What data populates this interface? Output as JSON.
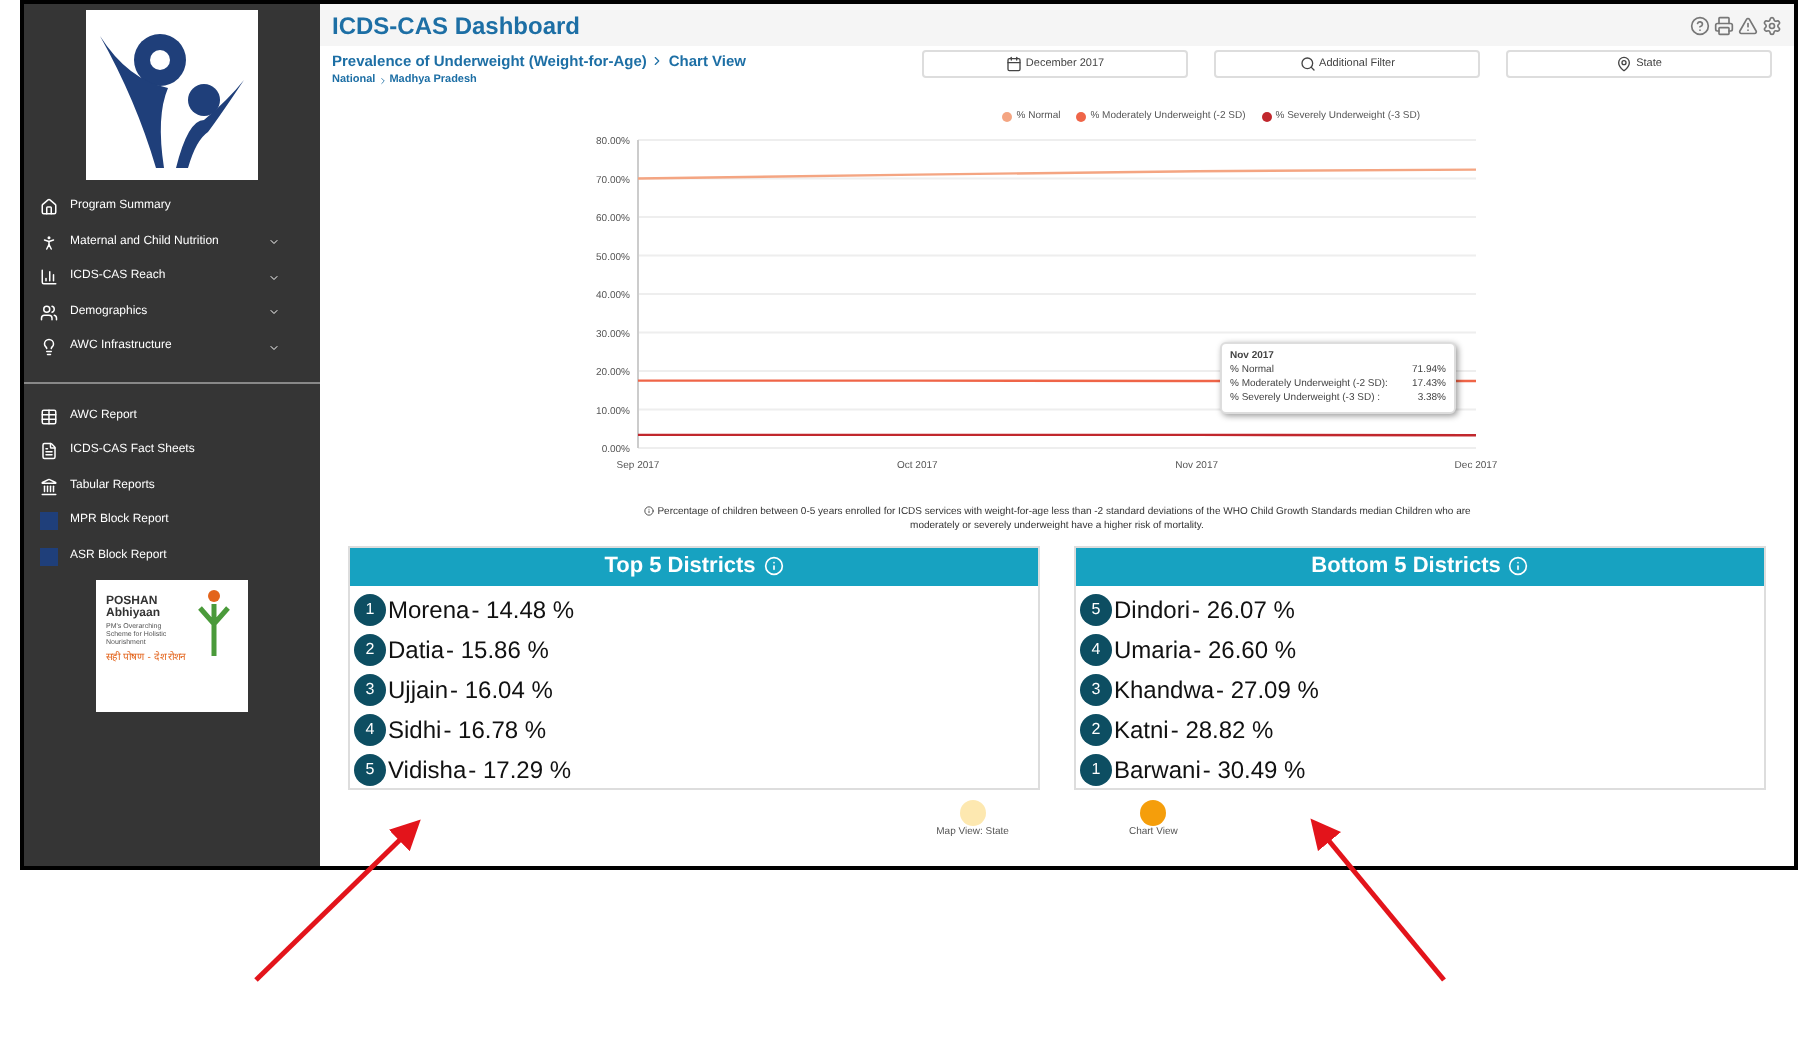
{
  "sidebar": {
    "items": [
      {
        "label": "Program Summary",
        "expandable": false
      },
      {
        "label": "Maternal and Child Nutrition",
        "expandable": true
      },
      {
        "label": "ICDS-CAS Reach",
        "expandable": true
      },
      {
        "label": "Demographics",
        "expandable": true
      },
      {
        "label": "AWC Infrastructure",
        "expandable": true
      }
    ],
    "reports": [
      {
        "label": "AWC Report"
      },
      {
        "label": "ICDS-CAS Fact Sheets"
      },
      {
        "label": "Tabular Reports"
      },
      {
        "label": "MPR Block Report"
      },
      {
        "label": "ASR Block Report"
      }
    ],
    "poshan_logo": {
      "title": "POSHAN",
      "subtitle": "Abhiyaan",
      "tagline": "PM's Overarching Scheme for Holistic Nourishment",
      "hindi": "सही पोषण - देश रोशन"
    }
  },
  "header": {
    "title": "ICDS-CAS Dashboard"
  },
  "breadcrumb": {
    "page": "Prevalence of Underweight (Weight-for-Age)",
    "view": "Chart View",
    "location": [
      "National",
      "Madhya Pradesh"
    ]
  },
  "filters": [
    {
      "label": "December 2017"
    },
    {
      "label": "Additional Filter"
    },
    {
      "label": "State"
    }
  ],
  "chart": {
    "chart_data": {
      "type": "line",
      "grid": true,
      "legend": true,
      "categories": [
        "Sep 2017",
        "Oct 2017",
        "Nov 2017",
        "Dec 2017"
      ],
      "ylim": [
        0,
        80
      ],
      "yticks": [
        {
          "value": 0,
          "label": "0.00%"
        },
        {
          "value": 10,
          "label": "10.00%"
        },
        {
          "value": 20,
          "label": "20.00%"
        },
        {
          "value": 30,
          "label": "30.00%"
        },
        {
          "value": 40,
          "label": "40.00%"
        },
        {
          "value": 50,
          "label": "50.00%"
        },
        {
          "value": 60,
          "label": "60.00%"
        },
        {
          "value": 70,
          "label": "70.00%"
        },
        {
          "value": 80,
          "label": "80.00%"
        }
      ],
      "series": [
        {
          "name": "% Normal",
          "color": "#f4a582",
          "values": [
            70.0,
            71.0,
            71.9,
            72.3
          ]
        },
        {
          "name": "% Moderately Underweight (-2 SD)",
          "color": "#ef6548",
          "values": [
            17.5,
            17.5,
            17.4,
            17.4
          ]
        },
        {
          "name": "% Severely Underweight (-3 SD)",
          "color": "#c1272d",
          "values": [
            3.4,
            3.4,
            3.4,
            3.3
          ]
        }
      ]
    },
    "tooltip": {
      "title": "Nov 2017",
      "rows": [
        {
          "label": "% Normal",
          "value": "71.94%"
        },
        {
          "label": "% Moderately Underweight (-2 SD):",
          "value": "17.43%"
        },
        {
          "label": "% Severely Underweight (-3 SD) :",
          "value": "3.38%"
        }
      ]
    }
  },
  "note": "Percentage of children between 0-5 years enrolled for ICDS services with weight-for-age less than -2 standard deviations of the WHO Child Growth Standards median Children who are moderately or severely underweight have a higher risk of mortality.",
  "cards": [
    {
      "title": "Top 5 Districts",
      "rows": [
        {
          "rank": "1",
          "name": "Morena",
          "value": "- 14.48 %"
        },
        {
          "rank": "2",
          "name": "Datia",
          "value": "- 15.86 %"
        },
        {
          "rank": "3",
          "name": "Ujjain",
          "value": "- 16.04 %"
        },
        {
          "rank": "4",
          "name": "Sidhi",
          "value": "- 16.78 %"
        },
        {
          "rank": "5",
          "name": "Vidisha",
          "value": "- 17.29 %"
        }
      ]
    },
    {
      "title": "Bottom 5 Districts",
      "rows": [
        {
          "rank": "5",
          "name": "Dindori",
          "value": "- 26.07 %"
        },
        {
          "rank": "4",
          "name": "Umaria",
          "value": "- 26.60 %"
        },
        {
          "rank": "3",
          "name": "Khandwa",
          "value": "- 27.09 %"
        },
        {
          "rank": "2",
          "name": "Katni",
          "value": "- 28.82 %"
        },
        {
          "rank": "1",
          "name": "Barwani",
          "value": "- 30.49 %"
        }
      ]
    }
  ],
  "views": [
    {
      "label": "Map View: State",
      "selected": false
    },
    {
      "label": "Chart View",
      "selected": true
    }
  ]
}
